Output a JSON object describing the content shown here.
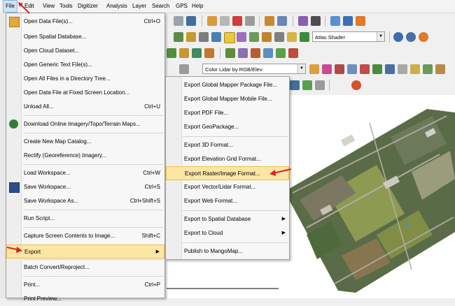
{
  "menubar": [
    "File",
    "Edit",
    "View",
    "Tools",
    "Digitizer",
    "Analysis",
    "Layer",
    "Search",
    "GPS",
    "Help"
  ],
  "toolbar": {
    "shader": "Atlas Shader",
    "lidar_color": "Color Lidar by RGB/Elev"
  },
  "file_menu": {
    "items": [
      {
        "label": "Open Data File(s)...",
        "shortcut": "Ctrl+O",
        "icon": "folder-icon"
      },
      {
        "label": "Open Spatial Database...",
        "shortcut": ""
      },
      {
        "label": "Open Cloud Dataset...",
        "shortcut": ""
      },
      {
        "label": "Open Generic Text File(s)...",
        "shortcut": ""
      },
      {
        "label": "Open All Files in a Directory Tree...",
        "shortcut": ""
      },
      {
        "label": "Open Data File at Fixed Screen Location...",
        "shortcut": ""
      },
      {
        "label": "Unload All...",
        "shortcut": "Ctrl+U"
      },
      {
        "label": "Download Online Imagery/Topo/Terrain Maps...",
        "shortcut": "",
        "icon": "globe-icon"
      },
      {
        "label": "Create New Map Catalog...",
        "shortcut": ""
      },
      {
        "label": "Rectify (Georeference) Imagery...",
        "shortcut": ""
      },
      {
        "label": "Load Workspace...",
        "shortcut": "Ctrl+W"
      },
      {
        "label": "Save Workspace...",
        "shortcut": "Ctrl+S",
        "icon": "floppy-disk-icon"
      },
      {
        "label": "Save Workspace As...",
        "shortcut": "Ctrl+Shift+S"
      },
      {
        "label": "Run Script...",
        "shortcut": ""
      },
      {
        "label": "Capture Screen Contents to Image...",
        "shortcut": "Shift+C"
      },
      {
        "label": "Export",
        "shortcut": ""
      },
      {
        "label": "Batch Convert/Reproject...",
        "shortcut": ""
      },
      {
        "label": "Print...",
        "shortcut": "Ctrl+P"
      },
      {
        "label": "Print Preview...",
        "shortcut": ""
      }
    ]
  },
  "export_submenu": {
    "items": [
      {
        "label": "Export Global Mapper Package File..."
      },
      {
        "label": "Export Global Mapper Mobile File..."
      },
      {
        "label": "Export PDF File..."
      },
      {
        "label": "Export GeoPackage..."
      },
      {
        "label": "Export 3D Format..."
      },
      {
        "label": "Export Elevation Grid Format..."
      },
      {
        "label": "Export Raster/Image Format..."
      },
      {
        "label": "Export Vector/Lidar Format..."
      },
      {
        "label": "Export Web Format..."
      },
      {
        "label": "Export to Spatial Database"
      },
      {
        "label": "Export to Cloud"
      },
      {
        "label": "Publish to MangoMap..."
      }
    ]
  },
  "colors": {
    "highlight": "#fbe6a4",
    "highlight_border": "#e9c24d",
    "annotation_arrow": "#e0202a"
  }
}
